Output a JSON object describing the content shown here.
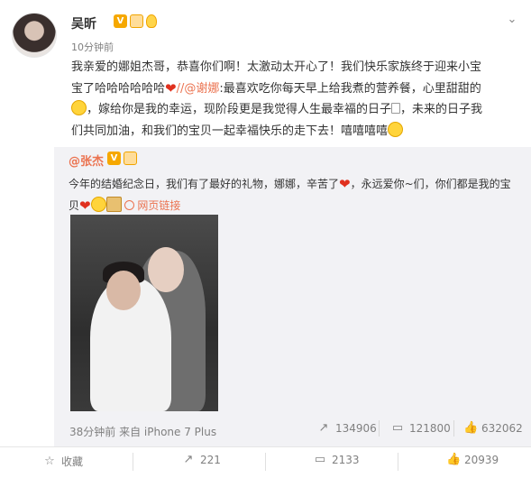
{
  "post": {
    "username": "吴昕",
    "time": "10分钟前",
    "content_line1": "我亲爱的娜姐杰哥，恭喜你们啊！太激动太开心了！我们快乐家族终于迎来小宝",
    "content_line2_a": "宝了哈哈哈哈哈哈",
    "content_line2_link": "//@谢娜",
    "content_line2_b": ":最喜欢吃你每天早上给我煮的营养餐，心里甜甜的",
    "content_line3_a": "，嫁给你是我的幸运，现阶段更是我觉得人生最幸福的日子",
    "content_line3_b": "，未来的日子我",
    "content_line4": "们共同加油，和我们的宝贝一起幸福快乐的走下去！嘻嘻嘻嘻"
  },
  "repost": {
    "username": "@张杰",
    "content_line1": "今年的结婚纪念日，我们有了最好的礼物，娜娜，辛苦了",
    "content_line1_b": "，永远爱你~们，你们都是我的宝",
    "content_line2": "贝",
    "weblink": "网页链接",
    "meta": "38分钟前 来自 iPhone 7 Plus",
    "shares": "134906",
    "comments": "121800",
    "likes": "632062"
  },
  "actions": {
    "favorite": "收藏",
    "share": "221",
    "comment": "2133",
    "like": "20939"
  },
  "icons": {
    "badge_v": "V",
    "chevron": "⌄",
    "share_icon": "↗",
    "comment_icon": "▭",
    "like_icon": "👍",
    "favorite_icon": "☆"
  }
}
